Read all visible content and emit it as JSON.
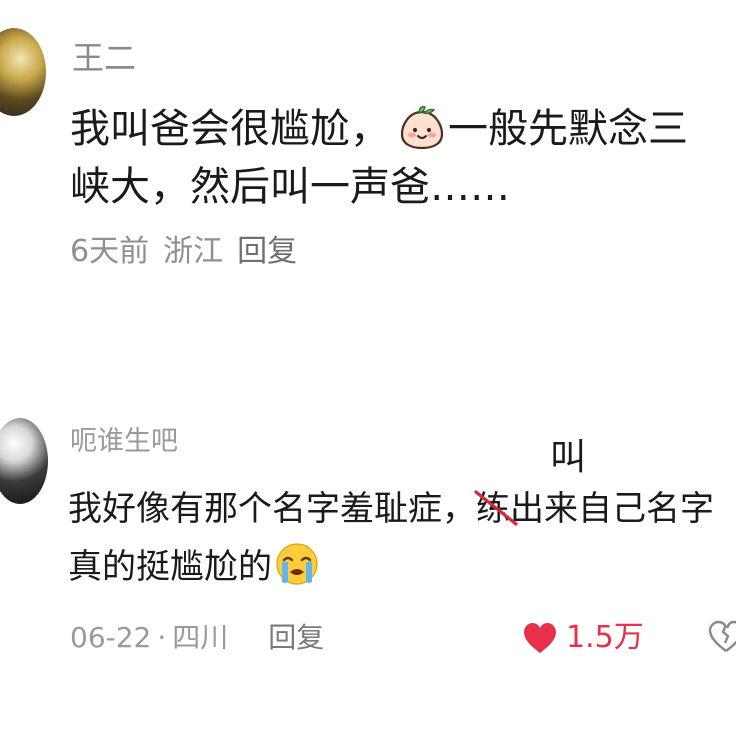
{
  "comments": [
    {
      "username": "王二",
      "text_before_emoji": "我叫爸会很尴尬，",
      "emoji": "smiling-peach-emoji",
      "text_after_emoji": "一般先默念三峡大，然后叫一声爸……",
      "time": "6天前",
      "location": "浙江",
      "reply_label": "回复"
    },
    {
      "username": "呃谁生吧",
      "text_part1": "我好像有那个名字羞耻症，",
      "struck_char": "练",
      "correction": "叫",
      "text_part2": "出来自己名字真的挺尴尬的",
      "emoji": "crying-face-emoji",
      "date": "06-22",
      "separator": "·",
      "location": "四川",
      "reply_label": "回复",
      "like_count": "1.5万",
      "liked": true
    }
  ],
  "colors": {
    "like_red": "#e8304c",
    "meta_gray": "#9a9a9a",
    "strike_red": "#d8283a"
  }
}
